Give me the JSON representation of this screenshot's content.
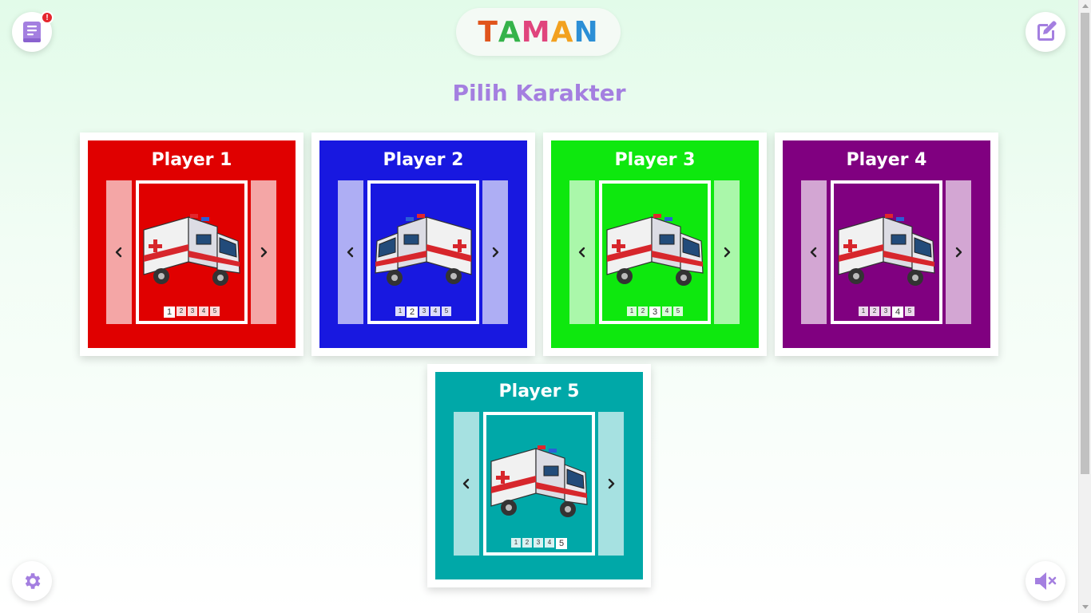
{
  "header": {
    "logo_letters": [
      "T",
      "A",
      "M",
      "A",
      "N"
    ],
    "logo_colors": [
      "#e0551c",
      "#34b34a",
      "#e0457d",
      "#f2a11f",
      "#2b8fd6"
    ]
  },
  "page_title": "Pilih Karakter",
  "notification_badge": "!",
  "players": [
    {
      "label": "Player 1",
      "color": "#e00000",
      "arrow_prev": "‹",
      "arrow_next": "›",
      "pages": [
        "1",
        "2",
        "3",
        "4",
        "5"
      ],
      "active_page": 0
    },
    {
      "label": "Player 2",
      "color": "#1818e0",
      "arrow_prev": "‹",
      "arrow_next": "›",
      "pages": [
        "1",
        "2",
        "3",
        "4",
        "5"
      ],
      "active_page": 1
    },
    {
      "label": "Player 3",
      "color": "#0ee80e",
      "arrow_prev": "‹",
      "arrow_next": "›",
      "pages": [
        "1",
        "2",
        "3",
        "4",
        "5"
      ],
      "active_page": 2
    },
    {
      "label": "Player 4",
      "color": "#800080",
      "arrow_prev": "‹",
      "arrow_next": "›",
      "pages": [
        "1",
        "2",
        "3",
        "4",
        "5"
      ],
      "active_page": 3
    },
    {
      "label": "Player 5",
      "color": "#00a8a8",
      "arrow_prev": "‹",
      "arrow_next": "›",
      "pages": [
        "1",
        "2",
        "3",
        "4",
        "5"
      ],
      "active_page": 4
    }
  ],
  "icons": {
    "book": "book-icon",
    "edit": "edit-icon",
    "settings": "gear-icon",
    "mute": "volume-mute-icon"
  },
  "accent_color": "#a47fe0"
}
